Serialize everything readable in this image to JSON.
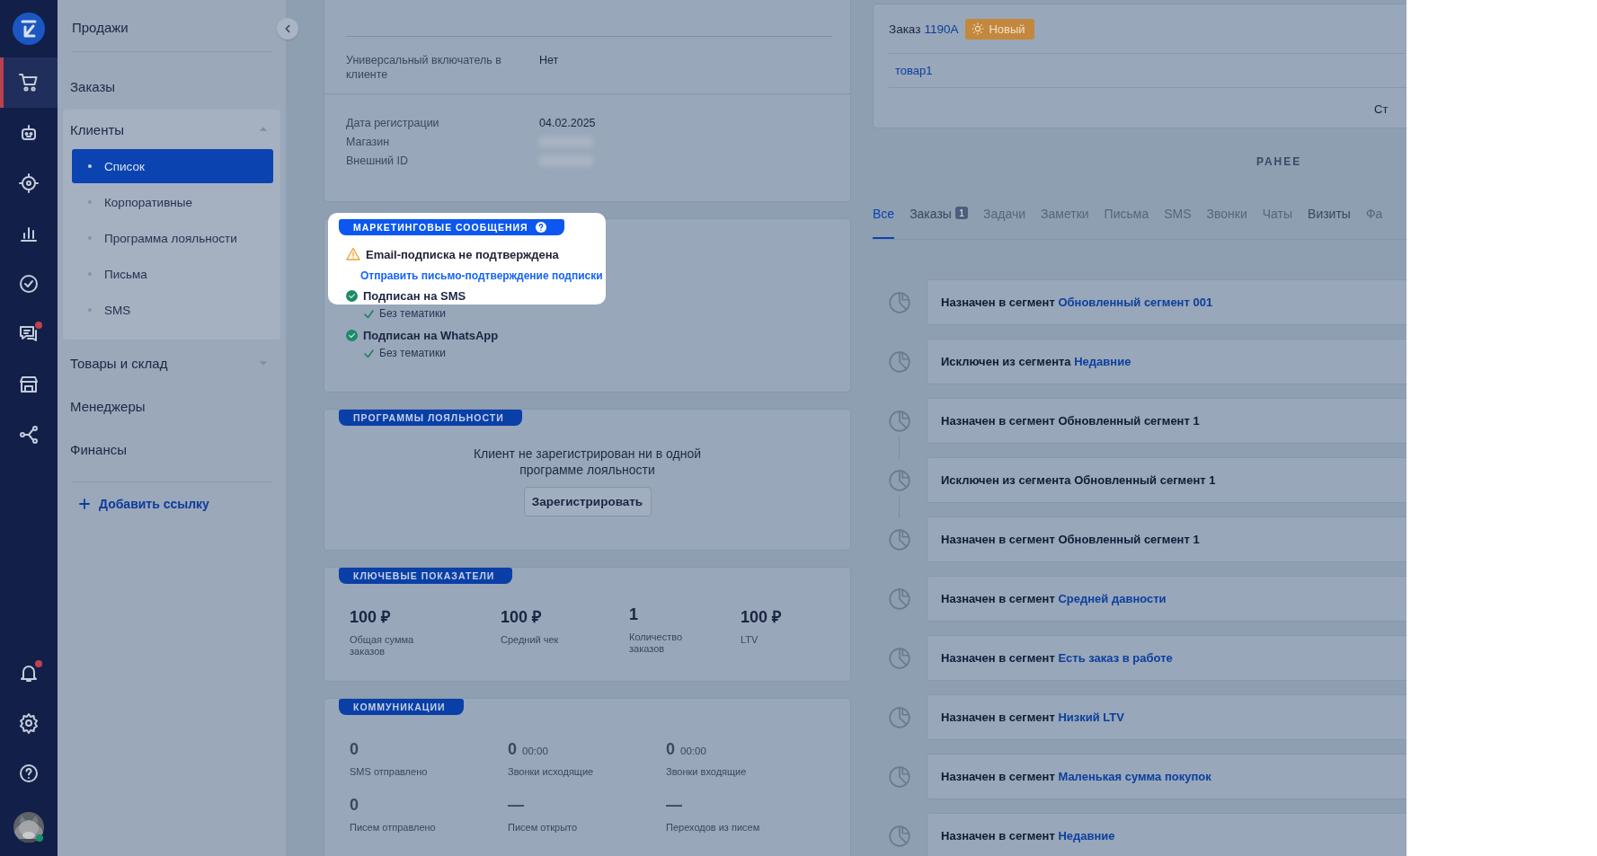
{
  "rail": {
    "items": [
      {
        "selected": true,
        "notification": false
      },
      {
        "selected": false,
        "notification": false
      },
      {
        "selected": false,
        "notification": false
      },
      {
        "selected": false,
        "notification": false
      },
      {
        "selected": false,
        "notification": false
      },
      {
        "selected": false,
        "notification": true
      },
      {
        "selected": false,
        "notification": false
      },
      {
        "selected": false,
        "notification": false
      }
    ],
    "footer": [
      {
        "notification": true
      },
      {
        "notification": false
      },
      {
        "notification": false
      }
    ],
    "avatar": {
      "online": true
    }
  },
  "sidebar": {
    "title": "Продажи",
    "items": [
      {
        "label": "Заказы",
        "selected": false
      },
      {
        "label": "Клиенты",
        "selected": false,
        "expanded": true,
        "children": [
          {
            "label": "Список",
            "selected": true
          },
          {
            "label": "Корпоративные",
            "selected": false
          },
          {
            "label": "Программа лояльности",
            "selected": false
          },
          {
            "label": "Письма",
            "selected": false
          },
          {
            "label": "SMS",
            "selected": false
          }
        ]
      },
      {
        "label": "Товары и склад",
        "selected": false,
        "expanded": false
      },
      {
        "label": "Менеджеры",
        "selected": false
      },
      {
        "label": "Финансы",
        "selected": false
      }
    ],
    "add_link": "Добавить ссылку"
  },
  "client": {
    "fields_top": [
      {
        "label": "Универсальный включатель в клиенте",
        "value": "Нет",
        "redacted": false
      }
    ],
    "fields": [
      {
        "label": "Дата регистрации",
        "value": "04.02.2025",
        "redacted": false
      },
      {
        "label": "Магазин",
        "redacted": true
      },
      {
        "label": "Внешний ID",
        "redacted": true
      }
    ]
  },
  "marketing": {
    "title": "МАРКЕТИНГОВЫЕ СООБЩЕНИЯ",
    "spotlight": true,
    "subscriptions": [
      {
        "kind": "warning",
        "label": "Email-подписка не подтверждена",
        "action": "Отправить письмо-подтверждение подписки"
      },
      {
        "kind": "subscribed",
        "label": "Подписан на SMS",
        "topics": [
          "Без тематики"
        ]
      },
      {
        "kind": "subscribed",
        "label": "Подписан на WhatsApp",
        "topics": [
          "Без тематики"
        ]
      }
    ]
  },
  "loyalty": {
    "title": "ПРОГРАММЫ ЛОЯЛЬНОСТИ",
    "message": "Клиент не зарегистрирован ни в одной программе лояльности",
    "button": "Зарегистрировать"
  },
  "metrics": {
    "title": "КЛЮЧЕВЫЕ ПОКАЗАТЕЛИ",
    "items": [
      {
        "value": "100 ₽",
        "label": "Общая сумма заказов"
      },
      {
        "value": "100 ₽",
        "label": "Средний чек"
      },
      {
        "value": "1",
        "label": "Количество заказов"
      },
      {
        "value": "100 ₽",
        "label": "LTV"
      }
    ]
  },
  "communications": {
    "title": "КОММУНИКАЦИИ",
    "items": [
      {
        "value": "0",
        "label": "SMS отправлено"
      },
      {
        "value": "0",
        "duration": "00:00",
        "label": "Звонки исходящие"
      },
      {
        "value": "0",
        "duration": "00:00",
        "label": "Звонки входящие"
      },
      {
        "value": "0",
        "label": "Писем отправлено"
      },
      {
        "value": "—",
        "label": "Писем открыто"
      },
      {
        "value": "—",
        "label": "Переходов из писем"
      }
    ]
  },
  "order": {
    "title": "Заказ",
    "number": "1190А",
    "status": "Новый",
    "product": "товар1",
    "footer_text": "Ст"
  },
  "history": {
    "heading": "РАНЕЕ",
    "tabs": [
      {
        "label": "Все",
        "selected": true,
        "disabled": false
      },
      {
        "label": "Заказы",
        "count": "1",
        "selected": false,
        "disabled": false
      },
      {
        "label": "Задачи",
        "selected": false,
        "disabled": true
      },
      {
        "label": "Заметки",
        "selected": false,
        "disabled": true
      },
      {
        "label": "Письма",
        "selected": false,
        "disabled": true
      },
      {
        "label": "SMS",
        "selected": false,
        "disabled": true
      },
      {
        "label": "Звонки",
        "selected": false,
        "disabled": true
      },
      {
        "label": "Чаты",
        "selected": false,
        "disabled": true
      },
      {
        "label": "Визиты",
        "selected": false,
        "disabled": false
      },
      {
        "label": "Фа",
        "selected": false,
        "disabled": true
      }
    ],
    "events": [
      {
        "text": "Назначен в сегмент",
        "segment": "Обновленный сегмент 001",
        "segment_link": true,
        "linked_to_next": false
      },
      {
        "text": "Исключен из сегмента",
        "segment": "Недавние",
        "segment_link": true,
        "linked_to_next": false
      },
      {
        "text": "Назначен в сегмент",
        "segment": "Обновленный сегмент 1",
        "segment_link": false,
        "linked_to_next": true
      },
      {
        "text": "Исключен из сегмента",
        "segment": "Обновленный сегмент 1",
        "segment_link": false,
        "linked_to_next": true
      },
      {
        "text": "Назначен в сегмент",
        "segment": "Обновленный сегмент 1",
        "segment_link": false,
        "linked_to_next": false
      },
      {
        "text": "Назначен в сегмент",
        "segment": "Средней давности",
        "segment_link": true,
        "linked_to_next": false
      },
      {
        "text": "Назначен в сегмент",
        "segment": "Есть заказ в работе",
        "segment_link": true,
        "linked_to_next": false
      },
      {
        "text": "Назначен в сегмент",
        "segment": "Низкий LTV",
        "segment_link": true,
        "linked_to_next": false
      },
      {
        "text": "Назначен в сегмент",
        "segment": "Маленькая сумма покупок",
        "segment_link": true,
        "linked_to_next": false
      },
      {
        "text": "Назначен в сегмент",
        "segment": "Недавние",
        "segment_link": true,
        "linked_to_next": false
      }
    ]
  }
}
